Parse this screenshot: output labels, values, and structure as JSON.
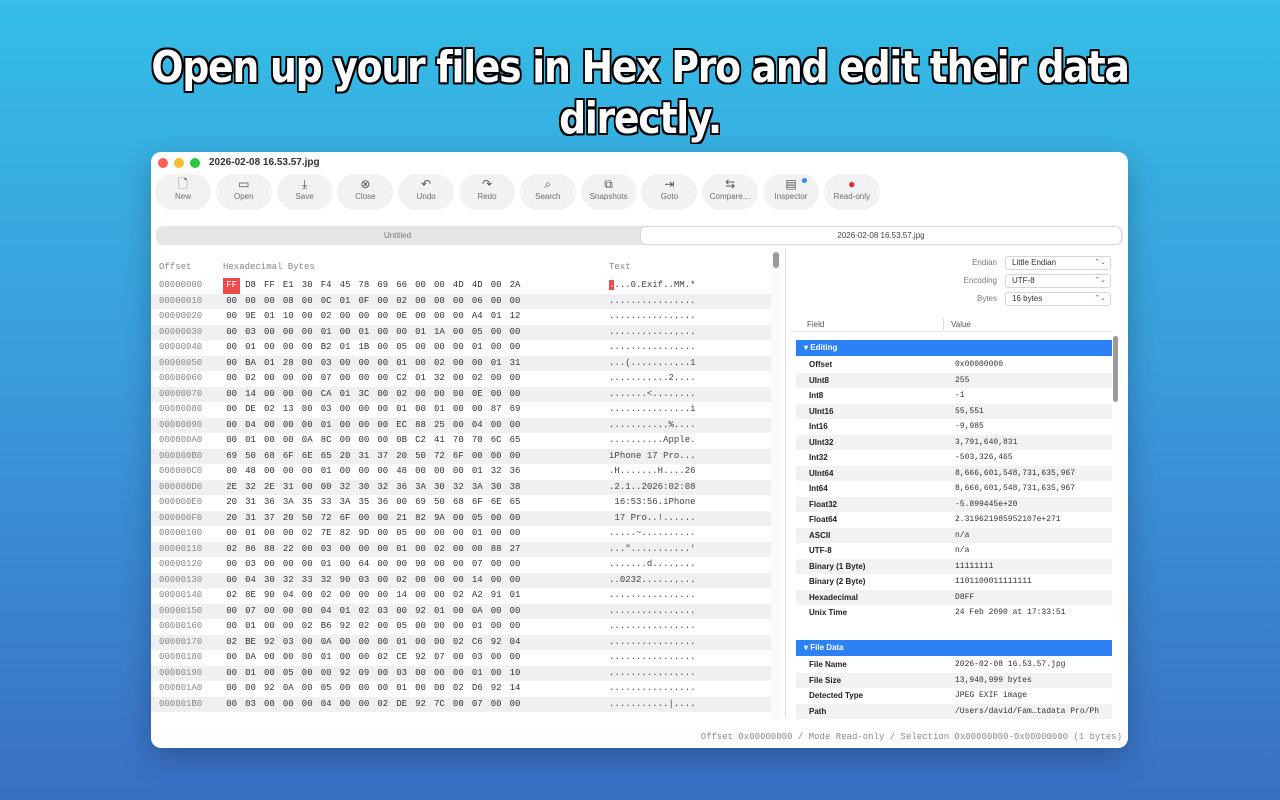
{
  "headline": "Open up your files in Hex Pro and edit their data directly.",
  "window": {
    "title": "2026-02-08 16.53.57.jpg"
  },
  "toolbar": [
    {
      "label": "New",
      "icon": "new-file-icon",
      "glyph": "🗋"
    },
    {
      "label": "Open",
      "icon": "folder-icon",
      "glyph": "▭"
    },
    {
      "label": "Save",
      "icon": "save-icon",
      "glyph": "⤓"
    },
    {
      "label": "Close",
      "icon": "close-icon",
      "glyph": "⊗"
    },
    {
      "label": "Undo",
      "icon": "undo-icon",
      "glyph": "↶"
    },
    {
      "label": "Redo",
      "icon": "redo-icon",
      "glyph": "↷"
    },
    {
      "label": "Search",
      "icon": "search-icon",
      "glyph": "⌕"
    },
    {
      "label": "Snapshots",
      "icon": "snapshots-icon",
      "glyph": "⧉"
    },
    {
      "label": "Goto",
      "icon": "goto-icon",
      "glyph": "⇥"
    },
    {
      "label": "Compare…",
      "icon": "compare-icon",
      "glyph": "⇆"
    },
    {
      "label": "Inspector",
      "icon": "inspector-icon",
      "glyph": "▤"
    },
    {
      "label": "Read-only",
      "icon": "record-icon",
      "glyph": "●"
    }
  ],
  "tabs": [
    "Untitled",
    "2026-02-08 16.53.57.jpg"
  ],
  "hex": {
    "header_offset": "Offset",
    "header_bytes": "Hexadecimal Bytes",
    "header_text": "Text",
    "rows": [
      {
        "offset": "00000000",
        "bytes": "FF D8 FF E1 30 F4 45 78 69 66 00 00 4D 4D 00 2A",
        "text": "....0.Exif..MM.*"
      },
      {
        "offset": "00000010",
        "bytes": "00 00 00 08 00 0C 01 0F 00 02 00 00 00 06 00 00",
        "text": "................"
      },
      {
        "offset": "00000020",
        "bytes": "00 9E 01 10 00 02 00 00 00 0E 00 00 00 A4 01 12",
        "text": "................"
      },
      {
        "offset": "00000030",
        "bytes": "00 03 00 00 00 01 00 01 00 00 01 1A 00 05 00 00",
        "text": "................"
      },
      {
        "offset": "00000040",
        "bytes": "00 01 00 00 00 B2 01 1B 00 05 00 00 00 01 00 00",
        "text": "................"
      },
      {
        "offset": "00000050",
        "bytes": "00 BA 01 28 00 03 00 00 00 01 00 02 00 00 01 31",
        "text": "...(...........1"
      },
      {
        "offset": "00000060",
        "bytes": "00 02 00 00 00 07 00 00 00 C2 01 32 00 02 00 00",
        "text": "...........2...."
      },
      {
        "offset": "00000070",
        "bytes": "00 14 00 00 00 CA 01 3C 00 02 00 00 00 0E 00 00",
        "text": ".......<........"
      },
      {
        "offset": "00000080",
        "bytes": "00 DE 02 13 00 03 00 00 00 01 00 01 00 00 87 69",
        "text": "...............i"
      },
      {
        "offset": "00000090",
        "bytes": "00 04 00 00 00 01 00 00 00 EC 88 25 00 04 00 00",
        "text": "...........%...."
      },
      {
        "offset": "000000A0",
        "bytes": "00 01 00 00 0A 8C 00 00 00 0B C2 41 70 70 6C 65",
        "text": "..........Apple."
      },
      {
        "offset": "000000B0",
        "bytes": "69 50 68 6F 6E 65 20 31 37 20 50 72 6F 00 00 00",
        "text": "iPhone 17 Pro..."
      },
      {
        "offset": "000000C0",
        "bytes": "00 48 00 00 00 01 00 00 00 48 00 00 00 01 32 36",
        "text": ".H.......H....26"
      },
      {
        "offset": "000000D0",
        "bytes": "2E 32 2E 31 00 00 32 30 32 36 3A 30 32 3A 30 38",
        "text": ".2.1..2026:02:08"
      },
      {
        "offset": "000000E0",
        "bytes": "20 31 36 3A 35 33 3A 35 36 00 69 50 68 6F 6E 65",
        "text": " 16:53:56.iPhone"
      },
      {
        "offset": "000000F0",
        "bytes": "20 31 37 20 50 72 6F 00 00 21 82 9A 00 05 00 00",
        "text": " 17 Pro..!......"
      },
      {
        "offset": "00000100",
        "bytes": "00 01 00 00 02 7E 82 9D 00 05 00 00 00 01 00 00",
        "text": ".....~.........."
      },
      {
        "offset": "00000110",
        "bytes": "02 86 88 22 00 03 00 00 00 01 00 02 00 00 88 27",
        "text": "...\"...........'"
      },
      {
        "offset": "00000120",
        "bytes": "00 03 00 00 00 01 00 64 00 00 90 00 00 07 00 00",
        "text": ".......d........"
      },
      {
        "offset": "00000130",
        "bytes": "00 04 30 32 33 32 90 03 00 02 00 00 00 14 00 00",
        "text": "..0232.........."
      },
      {
        "offset": "00000140",
        "bytes": "02 8E 90 04 00 02 00 00 00 14 00 00 02 A2 91 01",
        "text": "................"
      },
      {
        "offset": "00000150",
        "bytes": "00 07 00 00 00 04 01 02 03 00 92 01 00 0A 00 00",
        "text": "................"
      },
      {
        "offset": "00000160",
        "bytes": "00 01 00 00 02 B6 92 02 00 05 00 00 00 01 00 00",
        "text": "................"
      },
      {
        "offset": "00000170",
        "bytes": "02 BE 92 03 00 0A 00 00 00 01 00 00 02 C6 92 04",
        "text": "................"
      },
      {
        "offset": "00000180",
        "bytes": "00 0A 00 00 00 01 00 00 02 CE 92 07 00 03 00 00",
        "text": "................"
      },
      {
        "offset": "00000190",
        "bytes": "00 01 00 05 00 00 92 09 00 03 00 00 00 01 00 10",
        "text": "................"
      },
      {
        "offset": "000001A0",
        "bytes": "00 00 92 0A 00 05 00 00 00 01 00 00 02 D6 92 14",
        "text": "................"
      },
      {
        "offset": "000001B0",
        "bytes": "00 03 00 00 00 04 00 00 02 DE 92 7C 00 07 00 00",
        "text": "...........|...."
      }
    ]
  },
  "inspector": {
    "options": [
      {
        "label": "Endian",
        "value": "Little Endian"
      },
      {
        "label": "Encoding",
        "value": "UTF-8"
      },
      {
        "label": "Bytes",
        "value": "16 bytes"
      }
    ],
    "field_header": "Field",
    "value_header": "Value",
    "editing_title": "Editing",
    "editing": [
      {
        "k": "Offset",
        "v": "0x00000000"
      },
      {
        "k": "UInt8",
        "v": "255"
      },
      {
        "k": "Int8",
        "v": "-1"
      },
      {
        "k": "UInt16",
        "v": "55,551"
      },
      {
        "k": "Int16",
        "v": "-9,985"
      },
      {
        "k": "UInt32",
        "v": "3,791,640,831"
      },
      {
        "k": "Int32",
        "v": "-503,326,465"
      },
      {
        "k": "UInt64",
        "v": "8,666,601,548,731,635,967"
      },
      {
        "k": "Int64",
        "v": "8,666,601,548,731,635,967"
      },
      {
        "k": "Float32",
        "v": "-5.899445e+20"
      },
      {
        "k": "Float64",
        "v": "2.319621985952107e+271"
      },
      {
        "k": "ASCII",
        "v": "n/a"
      },
      {
        "k": "UTF-8",
        "v": "n/a"
      },
      {
        "k": "Binary (1 Byte)",
        "v": "11111111"
      },
      {
        "k": "Binary (2 Byte)",
        "v": "1101100011111111"
      },
      {
        "k": "Hexadecimal",
        "v": "D8FF"
      },
      {
        "k": "Unix Time",
        "v": "24 Feb 2090 at 17:33:51"
      }
    ],
    "filedata_title": "File Data",
    "filedata": [
      {
        "k": "File Name",
        "v": "2026-02-08 16.53.57.jpg"
      },
      {
        "k": "File Size",
        "v": "13,940,999 bytes"
      },
      {
        "k": "Detected Type",
        "v": "JPEG EXIF image"
      },
      {
        "k": "Path",
        "v": "/Users/david/Fam…tadata Pro/Ph"
      }
    ]
  },
  "status": "Offset 0x00000000 / Mode Read-only / Selection 0x00000000-0x00000000 (1 bytes)",
  "colors": {
    "accent": "#2c82f5",
    "selection": "#ef4b4b",
    "readonly_dot": "#e5252a"
  }
}
